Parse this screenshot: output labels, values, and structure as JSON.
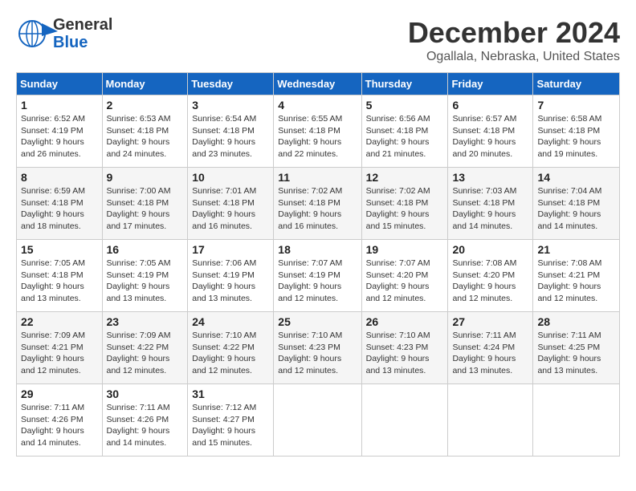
{
  "logo": {
    "general": "General",
    "blue": "Blue"
  },
  "header": {
    "month": "December 2024",
    "location": "Ogallala, Nebraska, United States"
  },
  "weekdays": [
    "Sunday",
    "Monday",
    "Tuesday",
    "Wednesday",
    "Thursday",
    "Friday",
    "Saturday"
  ],
  "weeks": [
    [
      {
        "day": "1",
        "sunrise": "6:52 AM",
        "sunset": "4:19 PM",
        "daylight": "9 hours and 26 minutes."
      },
      {
        "day": "2",
        "sunrise": "6:53 AM",
        "sunset": "4:18 PM",
        "daylight": "9 hours and 24 minutes."
      },
      {
        "day": "3",
        "sunrise": "6:54 AM",
        "sunset": "4:18 PM",
        "daylight": "9 hours and 23 minutes."
      },
      {
        "day": "4",
        "sunrise": "6:55 AM",
        "sunset": "4:18 PM",
        "daylight": "9 hours and 22 minutes."
      },
      {
        "day": "5",
        "sunrise": "6:56 AM",
        "sunset": "4:18 PM",
        "daylight": "9 hours and 21 minutes."
      },
      {
        "day": "6",
        "sunrise": "6:57 AM",
        "sunset": "4:18 PM",
        "daylight": "9 hours and 20 minutes."
      },
      {
        "day": "7",
        "sunrise": "6:58 AM",
        "sunset": "4:18 PM",
        "daylight": "9 hours and 19 minutes."
      }
    ],
    [
      {
        "day": "8",
        "sunrise": "6:59 AM",
        "sunset": "4:18 PM",
        "daylight": "9 hours and 18 minutes."
      },
      {
        "day": "9",
        "sunrise": "7:00 AM",
        "sunset": "4:18 PM",
        "daylight": "9 hours and 17 minutes."
      },
      {
        "day": "10",
        "sunrise": "7:01 AM",
        "sunset": "4:18 PM",
        "daylight": "9 hours and 16 minutes."
      },
      {
        "day": "11",
        "sunrise": "7:02 AM",
        "sunset": "4:18 PM",
        "daylight": "9 hours and 16 minutes."
      },
      {
        "day": "12",
        "sunrise": "7:02 AM",
        "sunset": "4:18 PM",
        "daylight": "9 hours and 15 minutes."
      },
      {
        "day": "13",
        "sunrise": "7:03 AM",
        "sunset": "4:18 PM",
        "daylight": "9 hours and 14 minutes."
      },
      {
        "day": "14",
        "sunrise": "7:04 AM",
        "sunset": "4:18 PM",
        "daylight": "9 hours and 14 minutes."
      }
    ],
    [
      {
        "day": "15",
        "sunrise": "7:05 AM",
        "sunset": "4:18 PM",
        "daylight": "9 hours and 13 minutes."
      },
      {
        "day": "16",
        "sunrise": "7:05 AM",
        "sunset": "4:19 PM",
        "daylight": "9 hours and 13 minutes."
      },
      {
        "day": "17",
        "sunrise": "7:06 AM",
        "sunset": "4:19 PM",
        "daylight": "9 hours and 13 minutes."
      },
      {
        "day": "18",
        "sunrise": "7:07 AM",
        "sunset": "4:19 PM",
        "daylight": "9 hours and 12 minutes."
      },
      {
        "day": "19",
        "sunrise": "7:07 AM",
        "sunset": "4:20 PM",
        "daylight": "9 hours and 12 minutes."
      },
      {
        "day": "20",
        "sunrise": "7:08 AM",
        "sunset": "4:20 PM",
        "daylight": "9 hours and 12 minutes."
      },
      {
        "day": "21",
        "sunrise": "7:08 AM",
        "sunset": "4:21 PM",
        "daylight": "9 hours and 12 minutes."
      }
    ],
    [
      {
        "day": "22",
        "sunrise": "7:09 AM",
        "sunset": "4:21 PM",
        "daylight": "9 hours and 12 minutes."
      },
      {
        "day": "23",
        "sunrise": "7:09 AM",
        "sunset": "4:22 PM",
        "daylight": "9 hours and 12 minutes."
      },
      {
        "day": "24",
        "sunrise": "7:10 AM",
        "sunset": "4:22 PM",
        "daylight": "9 hours and 12 minutes."
      },
      {
        "day": "25",
        "sunrise": "7:10 AM",
        "sunset": "4:23 PM",
        "daylight": "9 hours and 12 minutes."
      },
      {
        "day": "26",
        "sunrise": "7:10 AM",
        "sunset": "4:23 PM",
        "daylight": "9 hours and 13 minutes."
      },
      {
        "day": "27",
        "sunrise": "7:11 AM",
        "sunset": "4:24 PM",
        "daylight": "9 hours and 13 minutes."
      },
      {
        "day": "28",
        "sunrise": "7:11 AM",
        "sunset": "4:25 PM",
        "daylight": "9 hours and 13 minutes."
      }
    ],
    [
      {
        "day": "29",
        "sunrise": "7:11 AM",
        "sunset": "4:26 PM",
        "daylight": "9 hours and 14 minutes."
      },
      {
        "day": "30",
        "sunrise": "7:11 AM",
        "sunset": "4:26 PM",
        "daylight": "9 hours and 14 minutes."
      },
      {
        "day": "31",
        "sunrise": "7:12 AM",
        "sunset": "4:27 PM",
        "daylight": "9 hours and 15 minutes."
      },
      null,
      null,
      null,
      null
    ]
  ],
  "labels": {
    "sunrise": "Sunrise:",
    "sunset": "Sunset:",
    "daylight": "Daylight:"
  }
}
